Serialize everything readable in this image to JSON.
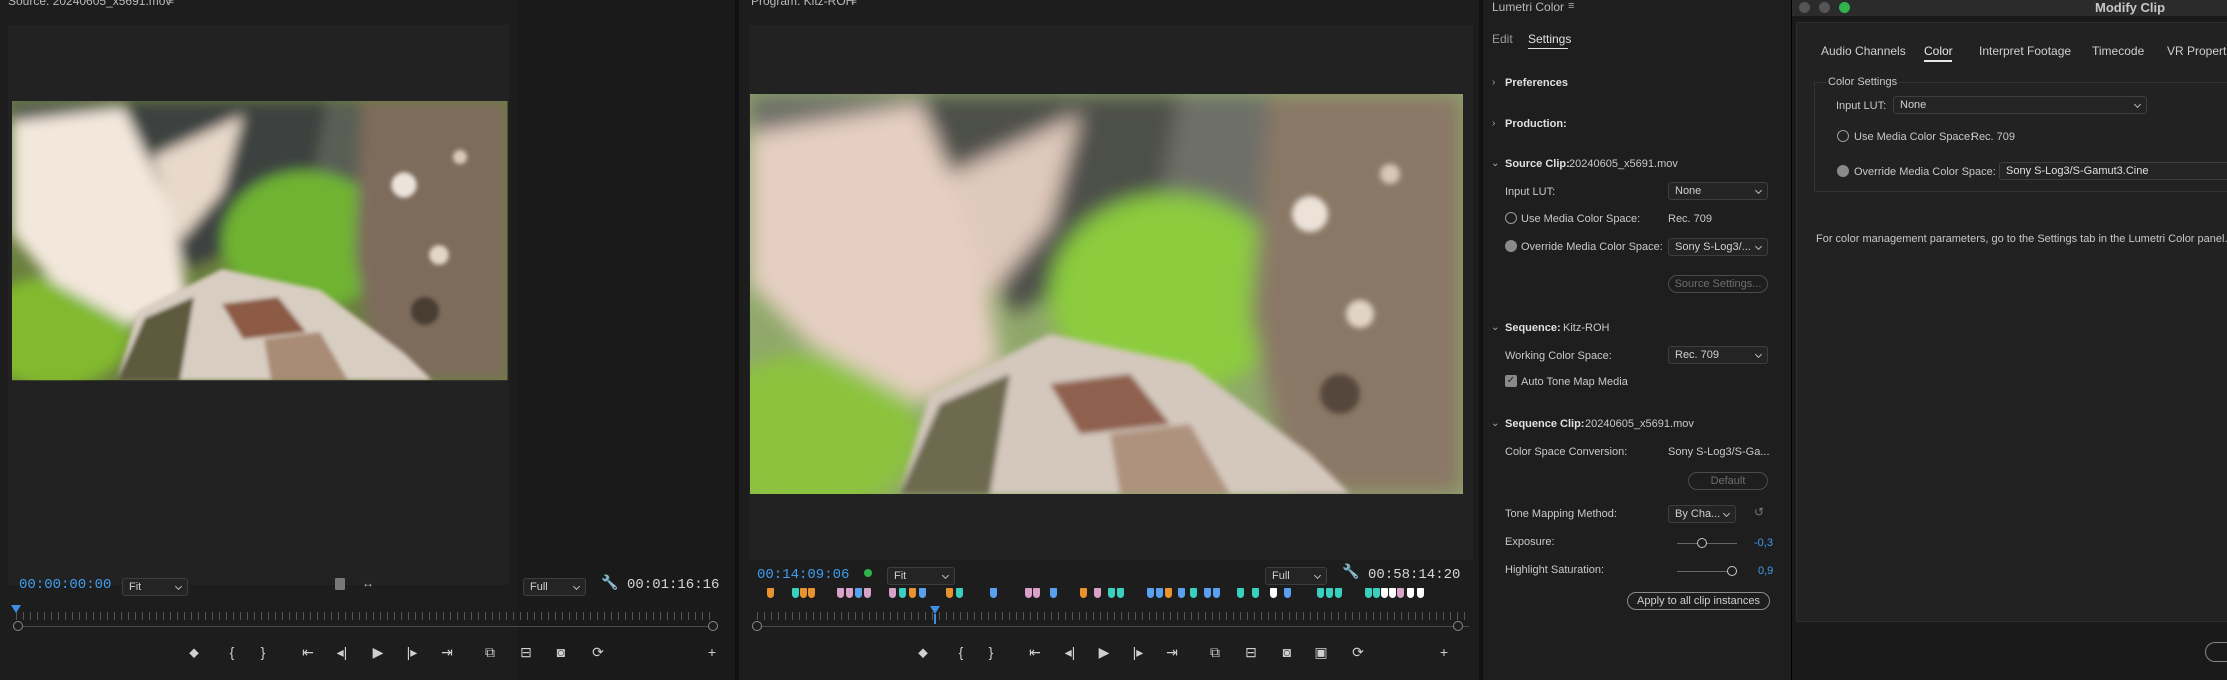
{
  "source": {
    "title": "Source: 20240605_x5691.mov",
    "timecode_in": "00:00:00:00",
    "zoom": "Fit",
    "resolution": "Full",
    "duration": "00:01:16:16"
  },
  "program": {
    "title": "Program: Kitz-ROH",
    "timecode_in": "00:14:09:06",
    "zoom": "Fit",
    "resolution": "Full",
    "duration": "00:58:14:20",
    "playhead_fraction": 0.25
  },
  "lumetri": {
    "title": "Lumetri Color",
    "tabs": [
      "Edit",
      "Settings"
    ],
    "active_tab": "Settings",
    "preferences": "Preferences",
    "production": "Production:",
    "source_clip_label": "Source Clip:",
    "source_clip_name": "20240605_x5691.mov",
    "input_lut_label": "Input LUT:",
    "input_lut_value": "None",
    "use_media_cs_label": "Use Media Color Space:",
    "use_media_cs_value": "Rec. 709",
    "override_cs_label": "Override Media Color Space:",
    "override_cs_value": "Sony S-Log3/...",
    "source_settings": "Source Settings...",
    "sequence_label": "Sequence:",
    "sequence_name": "Kitz-ROH",
    "working_cs_label": "Working Color Space:",
    "working_cs_value": "Rec. 709",
    "auto_tone_map": "Auto Tone Map Media",
    "sequence_clip_label": "Sequence Clip:",
    "sequence_clip_name": "20240605_x5691.mov",
    "cs_conversion_label": "Color Space Conversion:",
    "cs_conversion_value": "Sony S-Log3/S-Ga...",
    "default_btn": "Default",
    "tone_mapping_label": "Tone Mapping Method:",
    "tone_mapping_value": "By Cha...",
    "exposure_label": "Exposure:",
    "exposure_value": "-0,3",
    "highlight_sat_label": "Highlight Saturation:",
    "highlight_sat_value": "0,9",
    "apply_all": "Apply to all clip instances"
  },
  "modify_clip": {
    "title": "Modify Clip",
    "tabs": [
      "Audio Channels",
      "Color",
      "Interpret Footage",
      "Timecode",
      "VR Properties"
    ],
    "active_tab": "Color",
    "group_label": "Color Settings",
    "input_lut_label": "Input LUT:",
    "input_lut_value": "None",
    "use_media_cs_label": "Use Media Color Space:",
    "use_media_cs_value": "Rec. 709",
    "override_cs_label": "Override Media Color Space:",
    "override_cs_value": "Sony S-Log3/S-Gamut3.Cine",
    "note": "For color management parameters, go to the Settings tab in the Lumetri Color panel."
  },
  "colors": {
    "accent_blue": "#3f9cf0",
    "panel_bg": "#1d1d1d",
    "green_dot": "#2fb34a"
  }
}
